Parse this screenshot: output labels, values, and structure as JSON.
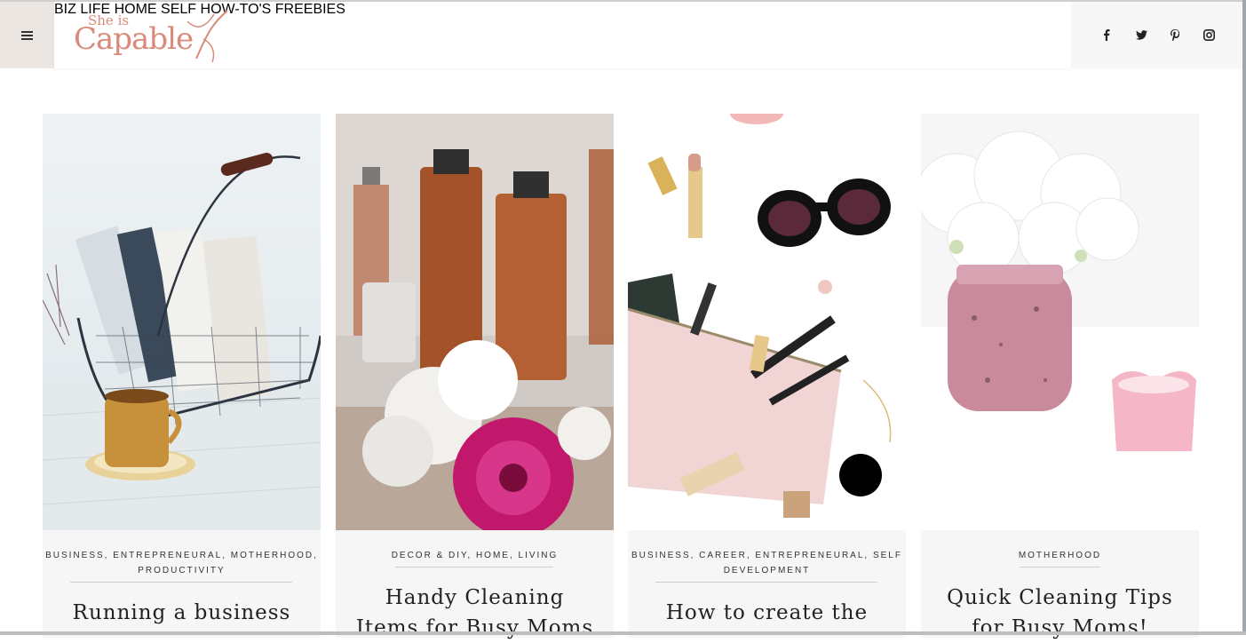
{
  "header": {
    "logo_top": "She is",
    "logo_main": "Capable",
    "nav": [
      "BIZ",
      "LIFE",
      "HOME",
      "SELF",
      "HOW-TO'S",
      "FREEBIES"
    ],
    "social": [
      "facebook-icon",
      "twitter-icon",
      "pinterest-icon",
      "instagram-icon"
    ]
  },
  "posts": [
    {
      "categories": "BUSINESS, ENTREPRENEURAL, MOTHERHOOD, PRODUCTIVITY",
      "title": "Running a business"
    },
    {
      "categories": "DECOR & DIY, HOME, LIVING",
      "title": "Handy Cleaning Items for Busy Moms"
    },
    {
      "categories": "BUSINESS, CAREER, ENTREPRENEURAL, SELF DEVELOPMENT",
      "title": "How to create the"
    },
    {
      "categories": "MOTHERHOOD",
      "title": "Quick Cleaning Tips for Busy Moms!"
    }
  ],
  "colors": {
    "accent": "#d98a7a",
    "menu_bg": "#ece6e2",
    "card_bg": "#f6f6f6"
  }
}
